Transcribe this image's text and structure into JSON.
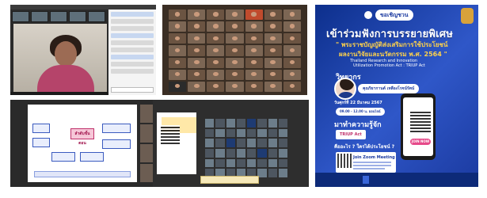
{
  "poster": {
    "invite_label": "ขอเชิญชวน",
    "org_text": "",
    "headline": "เข้าร่วมฟังการบรรยายพิเศษ",
    "subtitle_line1": "\" พระราชบัญญัติส่งเสริมการใช้ประโยชน์",
    "subtitle_line2": "ผลงานวิจัยและนวัตกรรม พ.ศ. 2564 \"",
    "english_line1": "Thailand Research and Innovation",
    "english_line2": "Utilization Promotion Act : TRIUP Act",
    "speaker_label": "วิทยากร",
    "speaker_name": "คุณริยากานต์ เหลืองโรจน์รัตน์",
    "date_text": "วันศุกร์ที่ 22 มีนาคม 2567",
    "time_text": "09.00 - 12.00 น. ออนไลน์",
    "cta_text": "มาทำความรู้จัก",
    "triup_label": "TRIUP Act",
    "question_text": "คืออะไร ? ใครได้ประโยชน์ ?",
    "zoom_title": "Join Zoom Meeting",
    "join_button": "JOIN NOW"
  },
  "slide": {
    "title": "",
    "hub_label": "ลำดับขั้นตอน"
  },
  "colors": {
    "poster_blue": "#1b3aa0",
    "poster_yellow": "#ffd24a",
    "accent_pink": "#e64a8a",
    "zoom_dark": "#2b2b2b"
  }
}
